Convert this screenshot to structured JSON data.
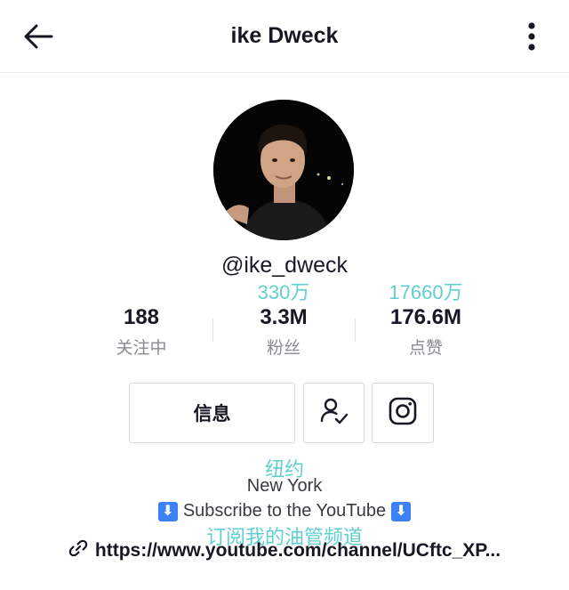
{
  "header": {
    "title": "ike Dweck"
  },
  "profile": {
    "handle": "@ike_dweck"
  },
  "stats": [
    {
      "translation": "",
      "value": "188",
      "label": "关注中"
    },
    {
      "translation": "330万",
      "value": "3.3M",
      "label": "粉丝"
    },
    {
      "translation": "17660万",
      "value": "176.6M",
      "label": "点赞"
    }
  ],
  "actions": {
    "message_label": "信息"
  },
  "bio": {
    "location_translation": "纽约",
    "location": "New York",
    "subscribe_text": "Subscribe to the YouTube",
    "subscribe_translation": "订阅我的油管频道",
    "arrow_glyph": "⬇",
    "link": "https://www.youtube.com/channel/UCftc_XP..."
  },
  "colors": {
    "accent_teal": "#5fd0d0",
    "text": "#161823",
    "muted": "#8a8b91"
  }
}
